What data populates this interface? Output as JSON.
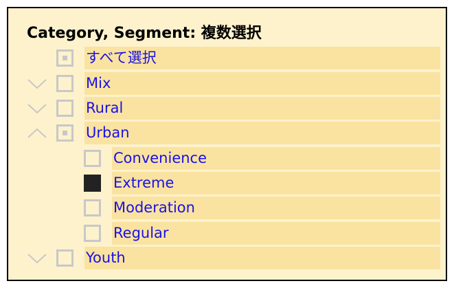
{
  "slicer": {
    "title": "Category, Segment: 複数選択",
    "colors": {
      "background": "#FDF2CC",
      "item_bg": "#FAE3A0",
      "text": "#1A10E8",
      "checkbox": "#C8C8C8",
      "checked": "#222222"
    },
    "items": [
      {
        "label": "すべて選択",
        "state": "partial",
        "expander": "none"
      },
      {
        "label": "Mix",
        "state": "unchecked",
        "expander": "chevron-down-icon"
      },
      {
        "label": "Rural",
        "state": "unchecked",
        "expander": "chevron-down-icon"
      },
      {
        "label": "Urban",
        "state": "partial",
        "expander": "chevron-up-icon",
        "children": [
          {
            "label": "Convenience",
            "state": "unchecked"
          },
          {
            "label": "Extreme",
            "state": "checked"
          },
          {
            "label": "Moderation",
            "state": "unchecked"
          },
          {
            "label": "Regular",
            "state": "unchecked"
          }
        ]
      },
      {
        "label": "Youth",
        "state": "unchecked",
        "expander": "chevron-down-icon"
      }
    ]
  }
}
